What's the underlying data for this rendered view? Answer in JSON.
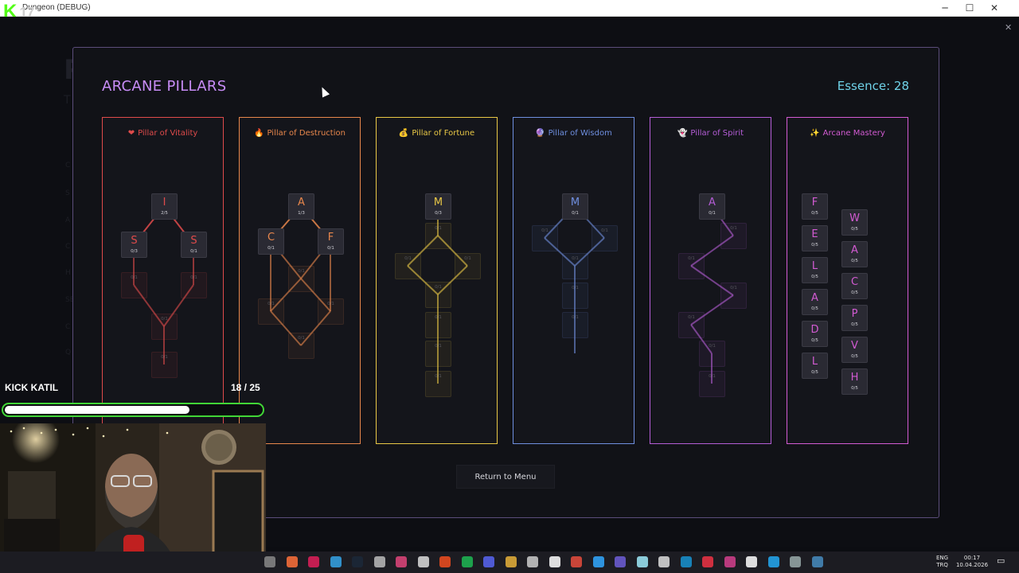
{
  "window": {
    "title": "Dungeon (DEBUG)",
    "minimize": "─",
    "maximize": "☐",
    "close": "✕"
  },
  "kick": {
    "logo_letter": "K",
    "logo_number": "17",
    "label": "KICK KATIL",
    "count": "18 / 25",
    "progress": 0.72
  },
  "background": {
    "title": "P",
    "subtitle": "T",
    "items": [
      "C",
      "S",
      "A",
      "C",
      "H",
      "SE",
      "C",
      "Q"
    ]
  },
  "panel": {
    "title": "ARCANE PILLARS",
    "essence_label": "Essence: 28",
    "return_button": "Return to Menu"
  },
  "colors": {
    "vitality": "#e04b4b",
    "destruction": "#e8874c",
    "fortune": "#e9c846",
    "wisdom": "#6f8fe0",
    "spirit": "#b45dd6",
    "mastery": "#d35bd3"
  },
  "pillars": [
    {
      "key": "vitality",
      "name": "Pillar of Vitality",
      "icon": "heart-icon",
      "glyph": "❤",
      "nodes": [
        {
          "letter": "I",
          "count": "2/5"
        },
        {
          "letter": "S",
          "count": "0/3"
        },
        {
          "letter": "S",
          "count": "0/1"
        },
        {
          "letter": "",
          "count": "0/1"
        },
        {
          "letter": "",
          "count": "0/1"
        },
        {
          "letter": "",
          "count": "0/1"
        },
        {
          "letter": "",
          "count": "0/1"
        }
      ]
    },
    {
      "key": "destruction",
      "name": "Pillar of Destruction",
      "icon": "flame-icon",
      "glyph": "🔥",
      "nodes": [
        {
          "letter": "A",
          "count": "1/3"
        },
        {
          "letter": "C",
          "count": "0/1"
        },
        {
          "letter": "F",
          "count": "0/1"
        },
        {
          "letter": "",
          "count": "0/1"
        },
        {
          "letter": "",
          "count": "0/1"
        },
        {
          "letter": "",
          "count": "0/1"
        },
        {
          "letter": "",
          "count": "0/1"
        }
      ]
    },
    {
      "key": "fortune",
      "name": "Pillar of Fortune",
      "icon": "money-bag-icon",
      "glyph": "💰",
      "nodes": [
        {
          "letter": "M",
          "count": "0/3"
        },
        {
          "letter": "",
          "count": "0/1"
        },
        {
          "letter": "",
          "count": "0/1"
        },
        {
          "letter": "",
          "count": "0/1"
        },
        {
          "letter": "",
          "count": "0/1"
        },
        {
          "letter": "",
          "count": "0/1"
        },
        {
          "letter": "",
          "count": "0/1"
        },
        {
          "letter": "",
          "count": "0/1"
        }
      ]
    },
    {
      "key": "wisdom",
      "name": "Pillar of Wisdom",
      "icon": "crystal-ball-icon",
      "glyph": "🔮",
      "nodes": [
        {
          "letter": "M",
          "count": "0/1"
        },
        {
          "letter": "",
          "count": "0/1"
        },
        {
          "letter": "",
          "count": "0/1"
        },
        {
          "letter": "",
          "count": "0/1"
        },
        {
          "letter": "",
          "count": "0/1"
        },
        {
          "letter": "",
          "count": "0/1"
        }
      ]
    },
    {
      "key": "spirit",
      "name": "Pillar of Spirit",
      "icon": "ghost-icon",
      "glyph": "👻",
      "nodes": [
        {
          "letter": "A",
          "count": "0/1"
        },
        {
          "letter": "",
          "count": "0/1"
        },
        {
          "letter": "",
          "count": "0/1"
        },
        {
          "letter": "",
          "count": "0/1"
        },
        {
          "letter": "",
          "count": "0/1"
        },
        {
          "letter": "",
          "count": "0/1"
        },
        {
          "letter": "",
          "count": "0/1"
        }
      ]
    },
    {
      "key": "mastery",
      "name": "Arcane Mastery",
      "icon": "sparkles-icon",
      "glyph": "✨",
      "nodes": [
        {
          "letter": "F",
          "count": "0/5"
        },
        {
          "letter": "E",
          "count": "0/5"
        },
        {
          "letter": "L",
          "count": "0/5"
        },
        {
          "letter": "A",
          "count": "0/5"
        },
        {
          "letter": "D",
          "count": "0/5"
        },
        {
          "letter": "L",
          "count": "0/5"
        },
        {
          "letter": "W",
          "count": "0/5"
        },
        {
          "letter": "A",
          "count": "0/5"
        },
        {
          "letter": "C",
          "count": "0/5"
        },
        {
          "letter": "P",
          "count": "0/5"
        },
        {
          "letter": "V",
          "count": "0/5"
        },
        {
          "letter": "H",
          "count": "0/5"
        }
      ]
    }
  ],
  "taskbar": {
    "icons": [
      "clock-icon",
      "firefox-icon",
      "slack-icon",
      "edge-icon",
      "steam-icon",
      "unity-icon",
      "xsplit-icon",
      "github-icon",
      "figma-icon",
      "spotify-icon",
      "discord-icon",
      "chrome-icon",
      "terminal-icon",
      "notion-icon",
      "adobe-icon",
      "photoshop-icon",
      "obs-icon",
      "electron-icon",
      "epic-icon",
      "arch-icon",
      "app-icon",
      "app-icon",
      "unreal-icon",
      "vscode-icon",
      "settings-icon",
      "godot-icon"
    ],
    "lang_top": "ENG",
    "lang_bottom": "TRQ",
    "time": "00:17",
    "date": "10.04.2026"
  }
}
